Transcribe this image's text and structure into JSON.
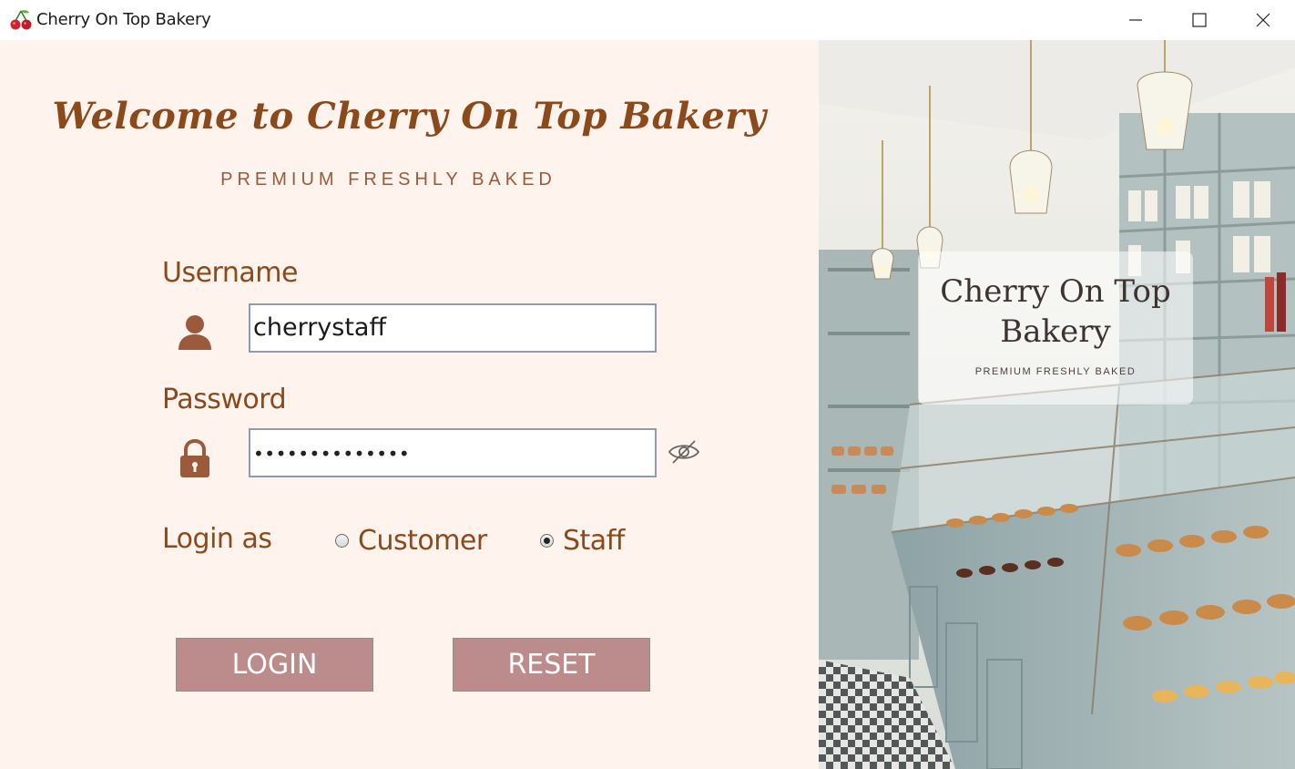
{
  "window": {
    "title": "Cherry On Top Bakery",
    "app_icon": "cherry-icon",
    "controls": [
      "minimize-icon",
      "maximize-icon",
      "close-icon"
    ]
  },
  "login": {
    "welcome": "Welcome to Cherry On Top Bakery",
    "tagline": "PREMIUM FRESHLY BAKED",
    "username_label": "Username",
    "username_value": "cherrystaff",
    "password_label": "Password",
    "password_masked": "••••••••••••••",
    "login_as_label": "Login as",
    "roles": [
      {
        "label": "Customer",
        "selected": false
      },
      {
        "label": "Staff",
        "selected": true
      }
    ],
    "login_button": "LOGIN",
    "reset_button": "RESET"
  },
  "hero": {
    "title": "Cherry On Top Bakery",
    "subtitle": "PREMIUM FRESHLY BAKED"
  },
  "colors": {
    "panel_bg": "#fff3ee",
    "heading": "#8b4a1c",
    "button": "#bc8c8c",
    "icon": "#9c5a3c"
  }
}
